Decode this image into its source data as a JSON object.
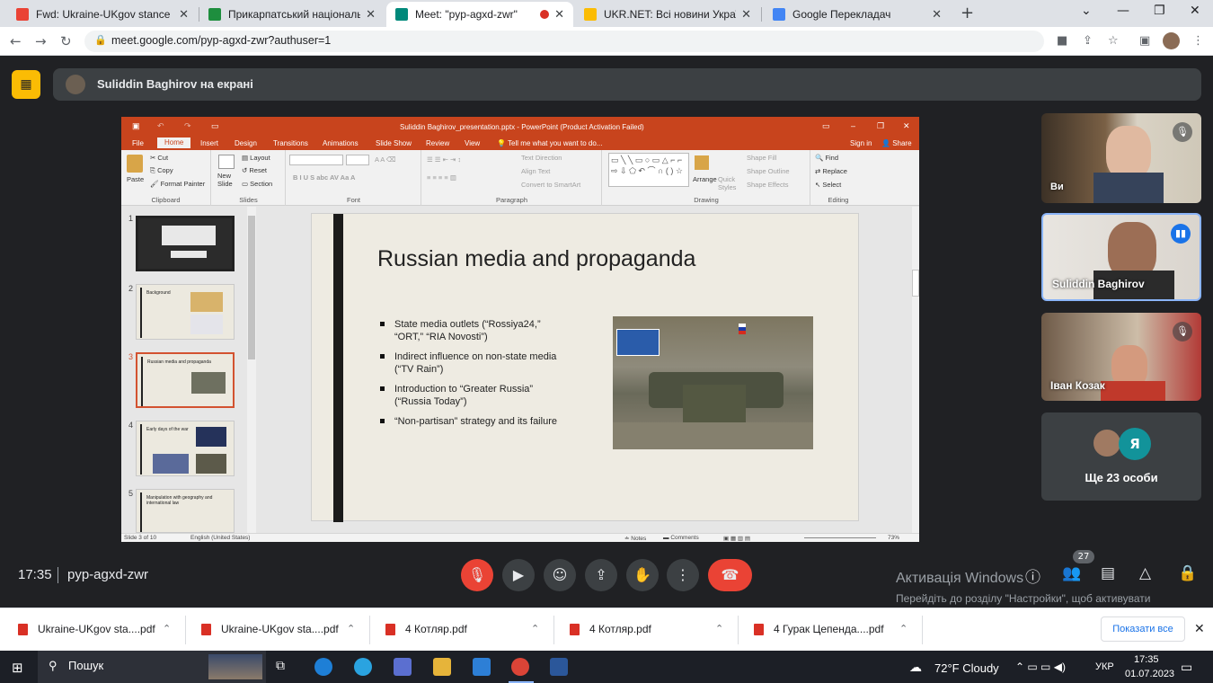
{
  "browser": {
    "tabs": [
      {
        "title": "Fwd: Ukraine-UKgov stance - iho",
        "icon": "gmail-icon",
        "color": "#ea4335"
      },
      {
        "title": "Прикарпатський національний",
        "icon": "classroom-icon",
        "color": "#1e8e3e"
      },
      {
        "title": "Meet: \"pyp-agxd-zwr\"",
        "icon": "meet-icon",
        "color": "#00897b"
      },
      {
        "title": "UKR.NET: Всі новини України, о",
        "icon": "ukrnet-icon",
        "color": "#fbbc04"
      },
      {
        "title": "Google Перекладач",
        "icon": "translate-icon",
        "color": "#4285f4"
      }
    ],
    "url": "meet.google.com/pyp-agxd-zwr?authuser=1"
  },
  "meet": {
    "presenter_label": "Suliddin Baghirov на екрані",
    "time": "17:35",
    "code": "pyp-agxd-zwr",
    "participant_count": "27",
    "participants": [
      {
        "name": "Ви"
      },
      {
        "name": "Suliddin Baghirov"
      },
      {
        "name": "Іван Козак"
      }
    ],
    "more_avatar_letter": "Я",
    "more_label": "Ще 23 особи",
    "activation_title": "Активація Windows",
    "activation_text": "Перейдіть до розділу \"Настройки\", щоб активувати Windows."
  },
  "ppt": {
    "window_title": "Suliddin Baghirov_presentation.pptx - PowerPoint (Product Activation Failed)",
    "tabs": [
      "File",
      "Home",
      "Insert",
      "Design",
      "Transitions",
      "Animations",
      "Slide Show",
      "Review",
      "View"
    ],
    "tell_me": "Tell me what you want to do...",
    "sign_in": "Sign in",
    "share": "Share",
    "ribbon": {
      "paste": "Paste",
      "cut": "Cut",
      "copy": "Copy",
      "format_painter": "Format Painter",
      "clipboard": "Clipboard",
      "new_slide": "New Slide",
      "layout": "Layout",
      "reset": "Reset",
      "section": "Section",
      "slides": "Slides",
      "font": "Font",
      "text_direction": "Text Direction",
      "align_text": "Align Text",
      "convert_smartart": "Convert to SmartArt",
      "paragraph": "Paragraph",
      "arrange": "Arrange",
      "quick_styles": "Quick Styles",
      "shape_fill": "Shape Fill",
      "shape_outline": "Shape Outline",
      "shape_effects": "Shape Effects",
      "drawing": "Drawing",
      "find": "Find",
      "replace": "Replace",
      "select": "Select",
      "editing": "Editing"
    },
    "thumbnails": [
      {
        "num": "1",
        "title": ""
      },
      {
        "num": "2",
        "title": "Background"
      },
      {
        "num": "3",
        "title": "Russian media and propaganda"
      },
      {
        "num": "4",
        "title": "Early days of the war"
      },
      {
        "num": "5",
        "title": "Manipulation with geography and international law"
      }
    ],
    "slide": {
      "title": "Russian media and propaganda",
      "bullets": [
        "State media outlets (“Rossiya24,” “ORT,” “RIA Novosti”)",
        "Indirect influence on non-state media (“TV Rain”)",
        "Introduction to “Greater Russia” (“Russia Today”)",
        "“Non-partisan” strategy and its failure"
      ]
    },
    "status": {
      "slide_info": "Slide 3 of 10",
      "language": "English (United States)",
      "notes": "Notes",
      "comments": "Comments",
      "zoom": "73%"
    }
  },
  "downloads": [
    "Ukraine-UKgov sta....pdf",
    "Ukraine-UKgov sta....pdf",
    "4 Котляр.pdf",
    "4 Котляр.pdf",
    "4 Гурак Цепенда....pdf"
  ],
  "downloads_show_all": "Показати все",
  "taskbar": {
    "search": "Пошук",
    "weather": "72°F  Cloudy",
    "lang": "УКР",
    "time": "17:35",
    "date": "01.07.2023"
  }
}
